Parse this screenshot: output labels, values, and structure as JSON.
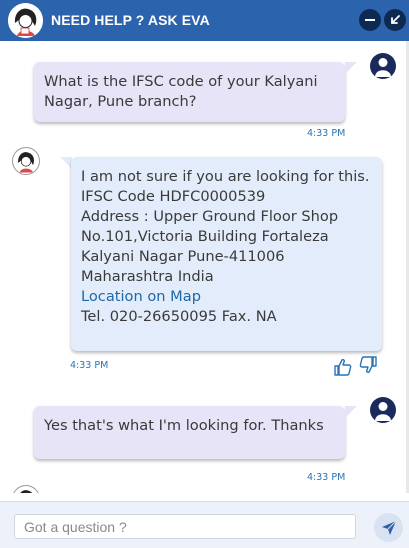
{
  "header": {
    "title": "NEED HELP ? ASK EVA",
    "icons": [
      "eva-avatar-icon",
      "minimize-icon",
      "popout-icon"
    ]
  },
  "messages": [
    {
      "sender": "user",
      "text": "What is the IFSC code of your Kalyani Nagar, Pune branch?",
      "time": "4:33 PM"
    },
    {
      "sender": "bot",
      "lines": [
        "I am not sure if you are looking for this.",
        "IFSC Code HDFC0000539",
        "Address : Upper Ground Floor Shop No.101,Victoria Building Fortaleza Kalyani Nagar Pune-411006 Maharashtra India"
      ],
      "link_text": "Location on Map",
      "tel_line": "Tel. 020-26650095 Fax. NA",
      "time": "4:33 PM",
      "feedback_icons": [
        "thumbs-up-icon",
        "thumbs-down-icon"
      ]
    },
    {
      "sender": "user",
      "text": "Yes that's what I'm looking for. Thanks",
      "time": "4:33 PM"
    }
  ],
  "composer": {
    "placeholder": "Got a question ?",
    "value": "",
    "send_icon": "send-icon"
  },
  "colors": {
    "header_bg": "#2b63ad",
    "user_bubble": "#e7e4f7",
    "bot_bubble": "#e3ecfa",
    "time_text": "#2a73b8",
    "link": "#1f67a6"
  }
}
